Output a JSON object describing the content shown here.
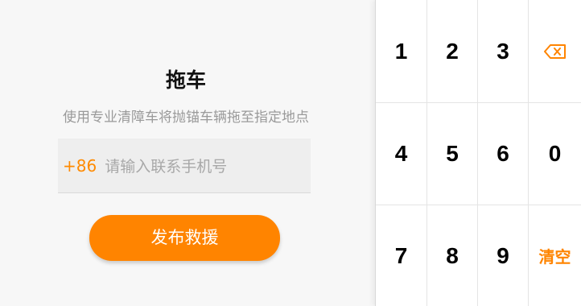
{
  "panel": {
    "title": "拖车",
    "subtitle": "使用专业清障车将抛锚车辆拖至指定地点",
    "phone_prefix": "+86",
    "phone_placeholder": "请输入联系手机号",
    "submit_label": "发布救援"
  },
  "keypad": {
    "keys": [
      "1",
      "2",
      "3",
      "4",
      "5",
      "6",
      "0",
      "7",
      "8",
      "9"
    ],
    "backspace_icon": "backspace-icon",
    "clear_label": "清空",
    "accent": "#ff8400"
  }
}
